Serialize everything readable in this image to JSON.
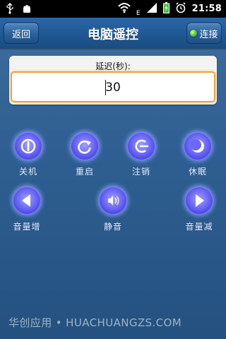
{
  "status_bar": {
    "time": "21:58",
    "network_label": "E",
    "icons": [
      "usb-icon",
      "android-debug-icon",
      "wifi-icon",
      "signal-icon",
      "battery-icon",
      "alarm-icon"
    ]
  },
  "header": {
    "title": "电脑遥控",
    "back_label": "返回",
    "connect_label": "连接",
    "connection_status_color": "#6bd32d"
  },
  "delay": {
    "label": "延迟(秒):",
    "value": "30"
  },
  "controls": {
    "shutdown": "关机",
    "restart": "重启",
    "logoff": "注销",
    "sleep": "休眠",
    "volume_up": "音量增",
    "mute": "静音",
    "volume_down": "音量减"
  },
  "footer": {
    "watermark": "华创应用 • HUACHUANGZS.COM"
  },
  "colors": {
    "accent_orange": "#f0a335",
    "button_purple": "#6b68f6",
    "titlebar_blue": "#1f5791"
  }
}
